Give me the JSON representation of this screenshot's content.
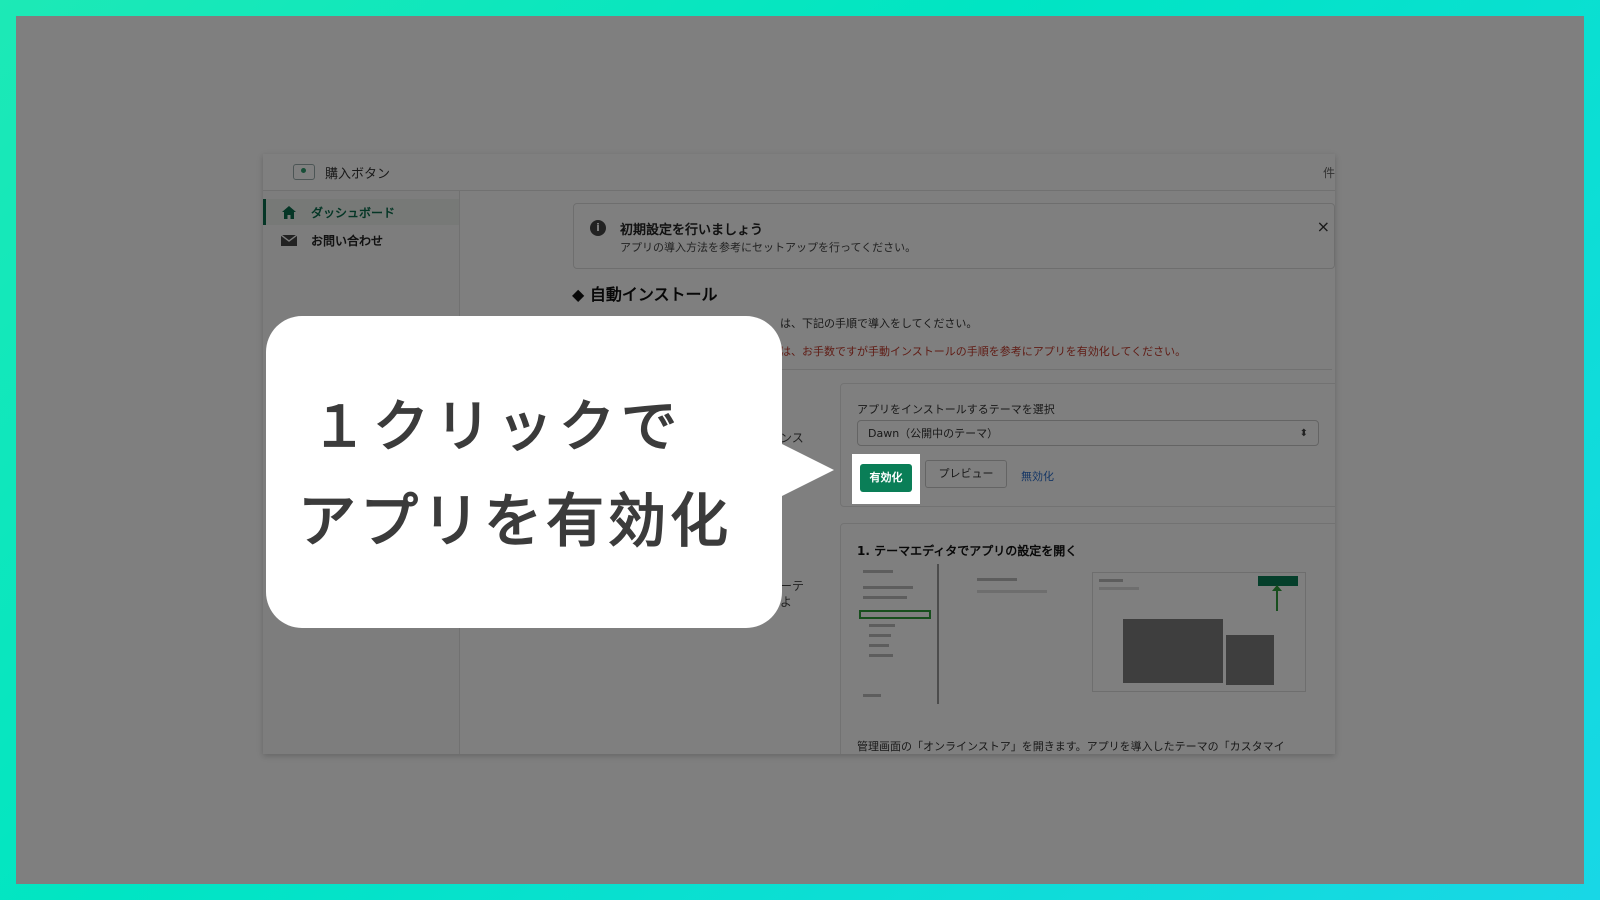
{
  "app": {
    "title": "購入ボタン",
    "header_trail": "件"
  },
  "sidebar": {
    "items": [
      {
        "label": "ダッシュボード",
        "icon": "home-icon",
        "active": true
      },
      {
        "label": "お問い合わせ",
        "icon": "mail-icon",
        "active": false
      }
    ]
  },
  "banner": {
    "title": "初期設定を行いましょう",
    "text": "アプリの導入方法を参考にセットアップを行ってください。",
    "close": "×"
  },
  "section": {
    "heading": "◆ 自動インストール",
    "desc1": "は、下記の手順で導入をしてください。",
    "desc2": "は、お手数ですが手動インストールの手順を参考にアプリを有効化してください。",
    "left_fragment": "ンス",
    "left_fragment2": "ーテ",
    "left_fragment3": "よ"
  },
  "install_card": {
    "label": "アプリをインストールするテーマを選択",
    "select_value": "Dawn（公開中のテーマ）",
    "enable_label": "有効化",
    "preview_label": "プレビュー",
    "disable_label": "無効化"
  },
  "step_card": {
    "title": "1. テーマエディタでアプリの設定を開く",
    "bottom_text": "管理画面の「オンラインストア」を開きます。アプリを導入したテーマの「カスタマイ"
  },
  "callout": {
    "line1": "１クリックで",
    "line2": "アプリを有効化"
  },
  "colors": {
    "accent": "#0a7e57",
    "warning": "#c0392b",
    "link": "#2c6ecb"
  }
}
